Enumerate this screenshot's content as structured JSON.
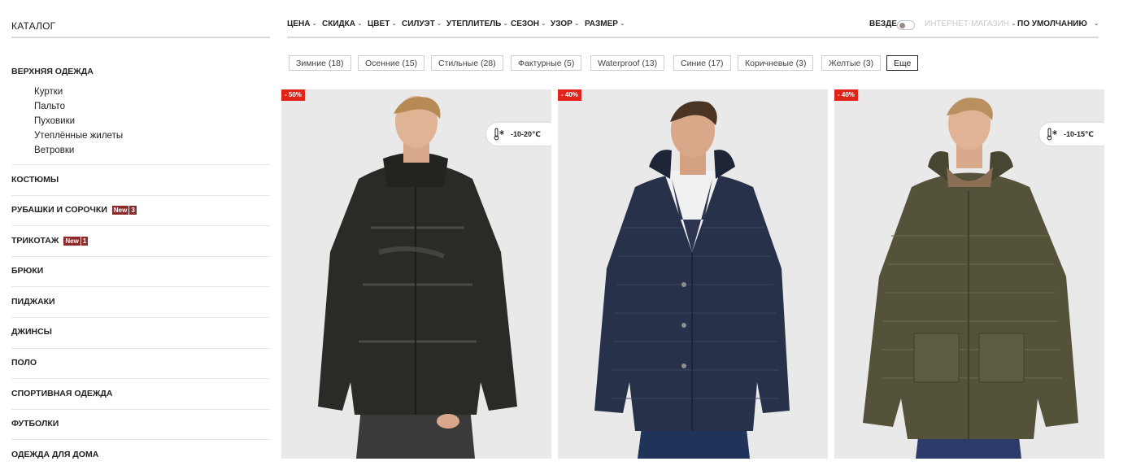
{
  "sidebar": {
    "title": "КАТАЛОГ",
    "section": "ВЕРХНЯЯ ОДЕЖДА",
    "subitems": [
      "Куртки",
      "Пальто",
      "Пуховики",
      "Утеплённые жилеты",
      "Ветровки"
    ],
    "items": [
      {
        "label": "КОСТЮМЫ"
      },
      {
        "label": "РУБАШКИ И СОРОЧКИ",
        "badge": "New",
        "count": "3"
      },
      {
        "label": "ТРИКОТАЖ",
        "badge": "New",
        "count": "1"
      },
      {
        "label": "БРЮКИ"
      },
      {
        "label": "ПИДЖАКИ"
      },
      {
        "label": "ДЖИНСЫ"
      },
      {
        "label": "ПОЛО"
      },
      {
        "label": "СПОРТИВНАЯ ОДЕЖДА"
      },
      {
        "label": "ФУТБОЛКИ"
      },
      {
        "label": "ОДЕЖДА ДЛЯ ДОМА"
      }
    ]
  },
  "filters": {
    "items": [
      "ЦЕНА",
      "СКИДКА",
      "ЦВЕТ",
      "СИЛУЭТ",
      "УТЕПЛИТЕЛЬ",
      "СЕЗОН",
      "УЗОР",
      "РАЗМЕР"
    ],
    "scope_all": "ВЕЗДЕ",
    "scope_online": "ИНТЕРНЕТ-МАГАЗИН",
    "sort": "ПО УМОЛЧАНИЮ"
  },
  "tags": [
    "Зимние (18)",
    "Осенние (15)",
    "Стильные (28)",
    "Фактурные (5)",
    "Waterproof (13)",
    "Синие (17)",
    "Коричневые (3)",
    "Желтые (3)"
  ],
  "tags_more": "Еще",
  "products": [
    {
      "discount": "- 50%",
      "temp": "-10-20℃"
    },
    {
      "discount": "- 40%"
    },
    {
      "discount": "- 40%",
      "temp": "-10-15℃"
    }
  ],
  "colors": {
    "accent_red": "#e2231a",
    "badge_dark_red": "#8c2a2a",
    "card_bg": "#e9e9e9"
  }
}
